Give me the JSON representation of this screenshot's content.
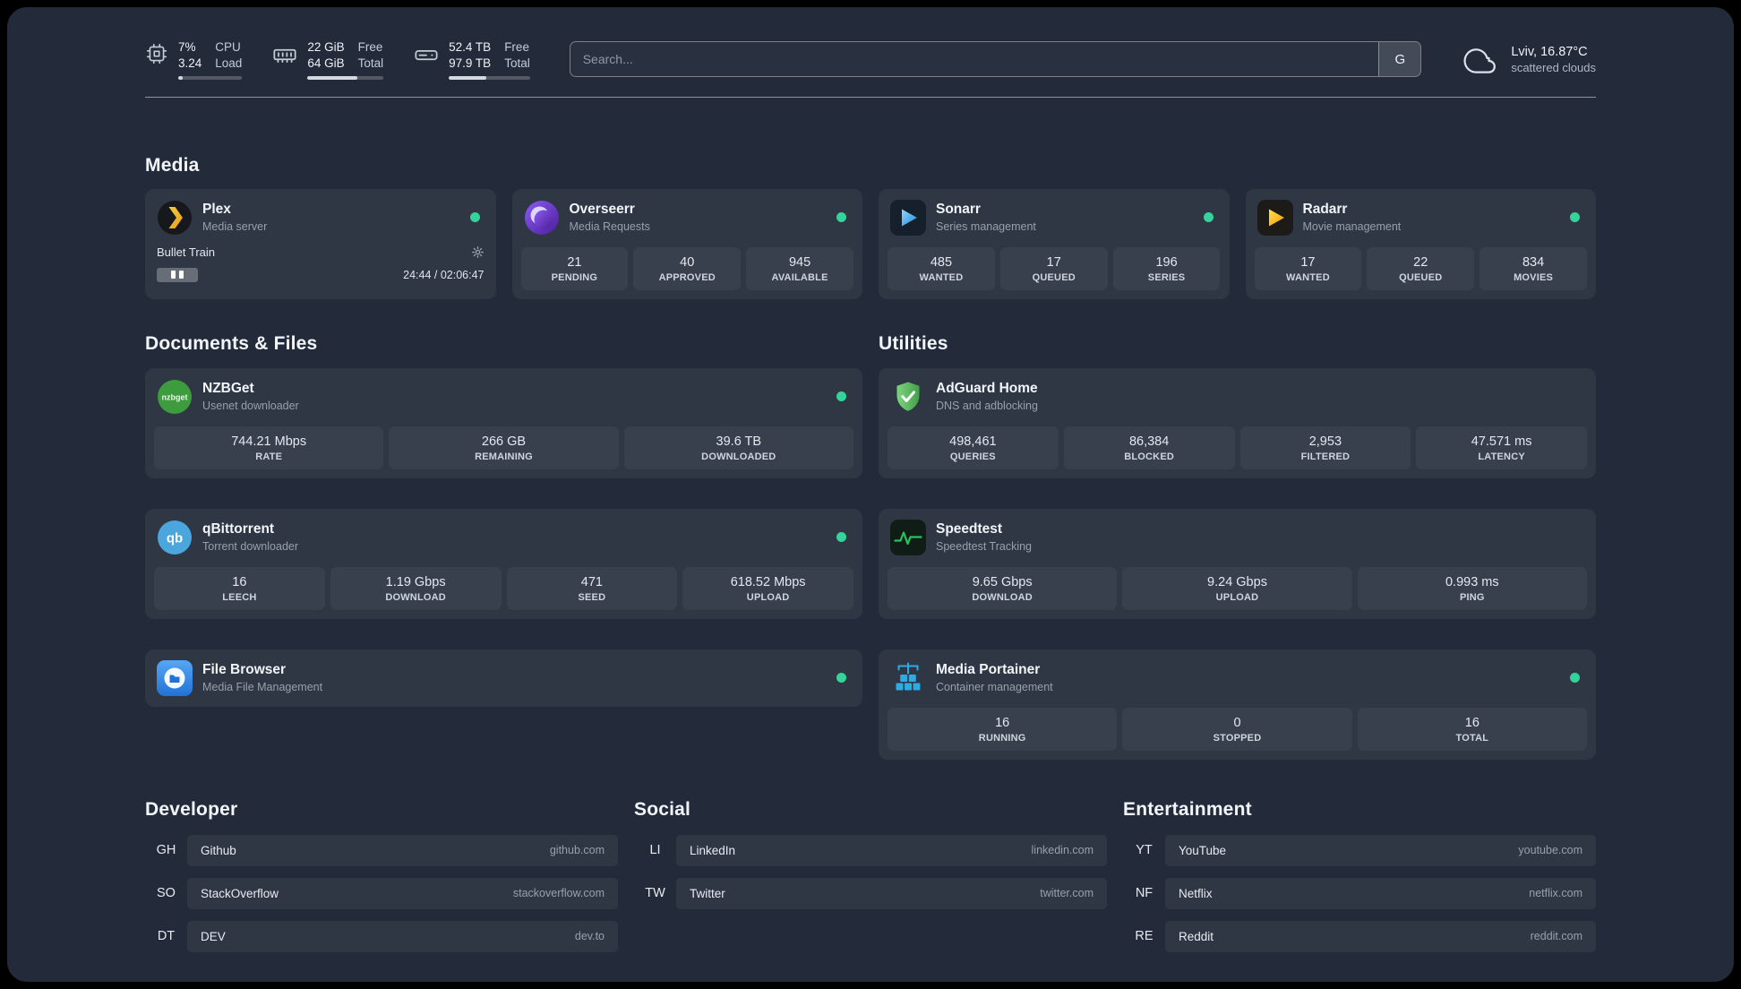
{
  "colors": {
    "background": "#232b3a",
    "status_online": "#34d399"
  },
  "topbar": {
    "cpu": {
      "percent": "7%",
      "load": "3.24",
      "label_top": "CPU",
      "label_bottom": "Load",
      "used_percent": "7%"
    },
    "memory": {
      "free": "22 GiB",
      "total": "64 GiB",
      "free_label": "Free",
      "total_label": "Total",
      "used_percent": "66%"
    },
    "disk": {
      "free": "52.4 TB",
      "total": "97.9 TB",
      "free_label": "Free",
      "total_label": "Total",
      "used_percent": "46%"
    },
    "search": {
      "placeholder": "Search...",
      "provider_button": "G"
    },
    "weather": {
      "location": "Lviv, 16.87°C",
      "condition": "scattered clouds"
    }
  },
  "icons": {
    "nzbget_text": "nzbget",
    "qbittorrent_text": "qb"
  },
  "groups": {
    "media": {
      "title": "Media",
      "services": [
        {
          "name": "Plex",
          "description": "Media server",
          "status": "online",
          "player": {
            "track": "Bullet Train",
            "time": "24:44 / 02:06:47"
          }
        },
        {
          "name": "Overseerr",
          "description": "Media Requests",
          "status": "online",
          "stats": [
            {
              "value": "21",
              "label": "PENDING"
            },
            {
              "value": "40",
              "label": "APPROVED"
            },
            {
              "value": "945",
              "label": "AVAILABLE"
            }
          ]
        },
        {
          "name": "Sonarr",
          "description": "Series management",
          "status": "online",
          "stats": [
            {
              "value": "485",
              "label": "WANTED"
            },
            {
              "value": "17",
              "label": "QUEUED"
            },
            {
              "value": "196",
              "label": "SERIES"
            }
          ]
        },
        {
          "name": "Radarr",
          "description": "Movie management",
          "status": "online",
          "stats": [
            {
              "value": "17",
              "label": "WANTED"
            },
            {
              "value": "22",
              "label": "QUEUED"
            },
            {
              "value": "834",
              "label": "MOVIES"
            }
          ]
        }
      ]
    },
    "documents": {
      "title": "Documents & Files",
      "services": [
        {
          "name": "NZBGet",
          "description": "Usenet downloader",
          "status": "online",
          "stats": [
            {
              "value": "744.21 Mbps",
              "label": "RATE"
            },
            {
              "value": "266 GB",
              "label": "REMAINING"
            },
            {
              "value": "39.6 TB",
              "label": "DOWNLOADED"
            }
          ]
        },
        {
          "name": "qBittorrent",
          "description": "Torrent downloader",
          "status": "online",
          "stats": [
            {
              "value": "16",
              "label": "LEECH"
            },
            {
              "value": "1.19 Gbps",
              "label": "DOWNLOAD"
            },
            {
              "value": "471",
              "label": "SEED"
            },
            {
              "value": "618.52 Mbps",
              "label": "UPLOAD"
            }
          ]
        },
        {
          "name": "File Browser",
          "description": "Media File Management",
          "status": "online",
          "stats": []
        }
      ]
    },
    "utilities": {
      "title": "Utilities",
      "services": [
        {
          "name": "AdGuard Home",
          "description": "DNS and adblocking",
          "stats": [
            {
              "value": "498,461",
              "label": "QUERIES"
            },
            {
              "value": "86,384",
              "label": "BLOCKED"
            },
            {
              "value": "2,953",
              "label": "FILTERED"
            },
            {
              "value": "47.571 ms",
              "label": "LATENCY"
            }
          ]
        },
        {
          "name": "Speedtest",
          "description": "Speedtest Tracking",
          "stats": [
            {
              "value": "9.65 Gbps",
              "label": "DOWNLOAD"
            },
            {
              "value": "9.24 Gbps",
              "label": "UPLOAD"
            },
            {
              "value": "0.993 ms",
              "label": "PING"
            }
          ]
        },
        {
          "name": "Media Portainer",
          "description": "Container management",
          "status": "online",
          "stats": [
            {
              "value": "16",
              "label": "RUNNING"
            },
            {
              "value": "0",
              "label": "STOPPED"
            },
            {
              "value": "16",
              "label": "TOTAL"
            }
          ]
        }
      ]
    }
  },
  "bookmarks": [
    {
      "title": "Developer",
      "items": [
        {
          "abbr": "GH",
          "name": "Github",
          "domain": "github.com"
        },
        {
          "abbr": "SO",
          "name": "StackOverflow",
          "domain": "stackoverflow.com"
        },
        {
          "abbr": "DT",
          "name": "DEV",
          "domain": "dev.to"
        }
      ]
    },
    {
      "title": "Social",
      "items": [
        {
          "abbr": "LI",
          "name": "LinkedIn",
          "domain": "linkedin.com"
        },
        {
          "abbr": "TW",
          "name": "Twitter",
          "domain": "twitter.com"
        }
      ]
    },
    {
      "title": "Entertainment",
      "items": [
        {
          "abbr": "YT",
          "name": "YouTube",
          "domain": "youtube.com"
        },
        {
          "abbr": "NF",
          "name": "Netflix",
          "domain": "netflix.com"
        },
        {
          "abbr": "RE",
          "name": "Reddit",
          "domain": "reddit.com"
        }
      ]
    }
  ]
}
